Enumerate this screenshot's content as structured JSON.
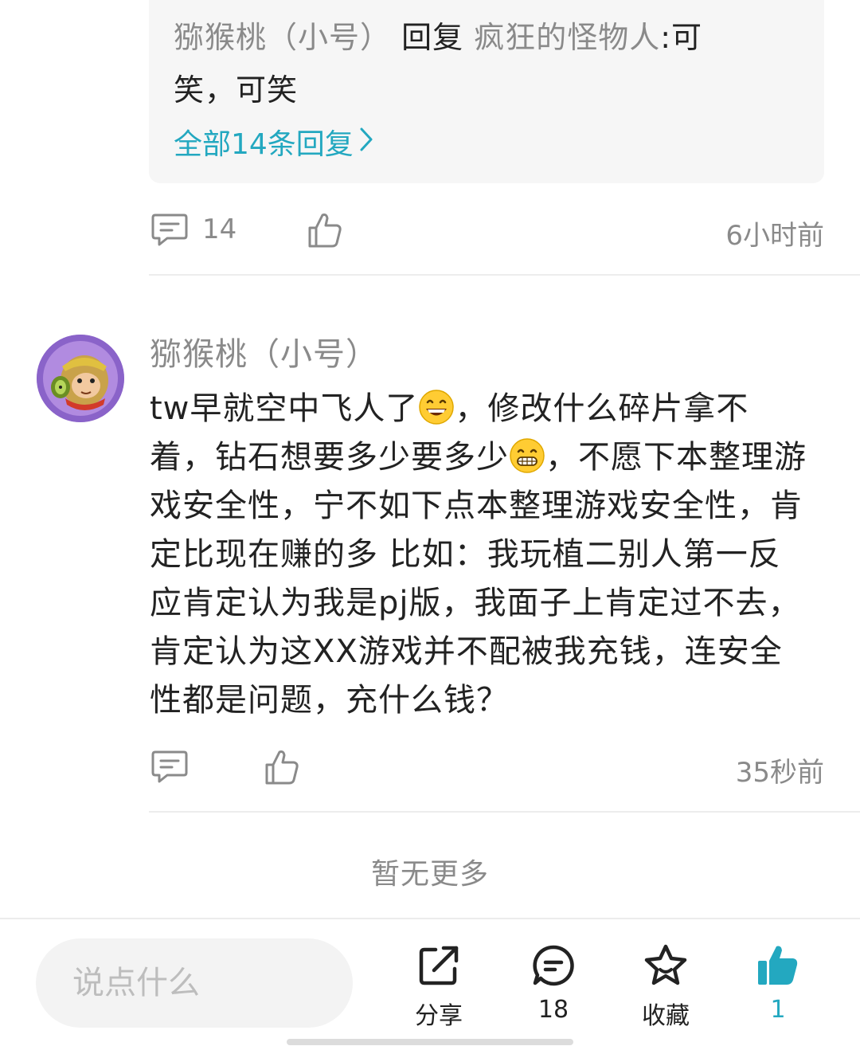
{
  "reply_preview": {
    "author": "猕猴桃（小号）",
    "reply_word": "回复",
    "target": "疯狂的怪物人",
    "separator": ":",
    "text_line1": "可",
    "text_line2": "笑，可笑",
    "all_replies": "全部14条回复"
  },
  "first_comment_actions": {
    "reply_count": "14",
    "time": "6小时前"
  },
  "comment": {
    "username": "猕猴桃（小号）",
    "seg1": "tw早就空中飞人了",
    "seg2": "，修改什么碎片拿不着，钻石想要多少要多少",
    "seg3": "，不愿下本整理游戏安全性，宁不如下点本整理游戏安全性，肯定比现在赚的多 比如：我玩植二别人第一反应肯定认为我是pj版，我面子上肯定过不去，肯定认为这XX游戏并不配被我充钱，连安全性都是问题，充什么钱？",
    "time": "35秒前"
  },
  "no_more": "暂无更多",
  "bottom_bar": {
    "input_placeholder": "说点什么",
    "share_label": "分享",
    "comment_count": "18",
    "favorite_label": "收藏",
    "like_count": "1"
  },
  "colors": {
    "accent": "#23a8c0",
    "muted": "#8a8a8a",
    "text": "#222222"
  }
}
